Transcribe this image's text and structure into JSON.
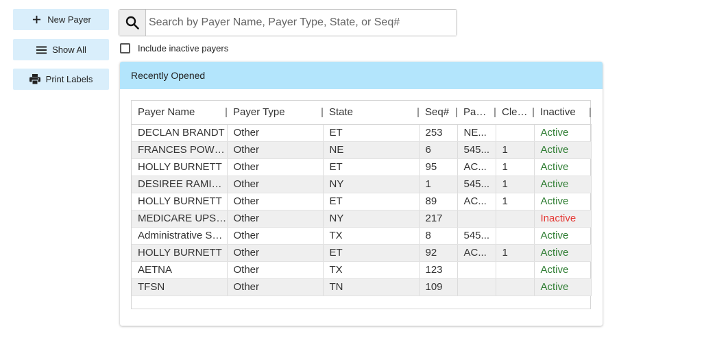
{
  "sidebar": {
    "new_payer": "New Payer",
    "show_all": "Show All",
    "print_labels": "Print Labels"
  },
  "search": {
    "placeholder": "Search by Payer Name, Payer Type, State, or Seq#",
    "value": ""
  },
  "include_inactive": {
    "label": "Include inactive payers",
    "checked": false
  },
  "panel": {
    "title": "Recently Opened"
  },
  "table": {
    "columns": [
      "Payer Name",
      "Payer Type",
      "State",
      "Seq#",
      "Payer ID",
      "Clearinghouse",
      "Inactive"
    ],
    "rows": [
      {
        "name": "DECLAN BRANDT",
        "type": "Other",
        "state": "ET",
        "seq": "253",
        "payer": "NE...",
        "clear": "",
        "status": "Active"
      },
      {
        "name": "FRANCES POWELL",
        "type": "Other",
        "state": "NE",
        "seq": "6",
        "payer": "545...",
        "clear": "1",
        "status": "Active"
      },
      {
        "name": "HOLLY BURNETT",
        "type": "Other",
        "state": "ET",
        "seq": "95",
        "payer": "AC...",
        "clear": "1",
        "status": "Active"
      },
      {
        "name": "DESIREE RAMIREZ",
        "type": "Other",
        "state": "NY",
        "seq": "1",
        "payer": "545...",
        "clear": "1",
        "status": "Active"
      },
      {
        "name": "HOLLY BURNETT",
        "type": "Other",
        "state": "ET",
        "seq": "89",
        "payer": "AC...",
        "clear": "1",
        "status": "Active"
      },
      {
        "name": "MEDICARE UPSTATE",
        "type": "Other",
        "state": "NY",
        "seq": "217",
        "payer": "",
        "clear": "",
        "status": "Inactive"
      },
      {
        "name": "Administrative Services",
        "type": "Other",
        "state": "TX",
        "seq": "8",
        "payer": "545...",
        "clear": "",
        "status": "Active"
      },
      {
        "name": "HOLLY BURNETT",
        "type": "Other",
        "state": "ET",
        "seq": "92",
        "payer": "AC...",
        "clear": "1",
        "status": "Active"
      },
      {
        "name": "AETNA",
        "type": "Other",
        "state": "TX",
        "seq": "123",
        "payer": "",
        "clear": "",
        "status": "Active"
      },
      {
        "name": "TFSN",
        "type": "Other",
        "state": "TN",
        "seq": "109",
        "payer": "",
        "clear": "",
        "status": "Active"
      }
    ]
  },
  "colors": {
    "button_bg": "#d9eefb",
    "panel_header_bg": "#b3e5fc",
    "active": "#2e7d32",
    "inactive": "#e53935"
  },
  "icons": {
    "new_payer": "plus-icon",
    "show_all": "menu-icon",
    "print_labels": "printer-icon",
    "search": "search-icon"
  }
}
